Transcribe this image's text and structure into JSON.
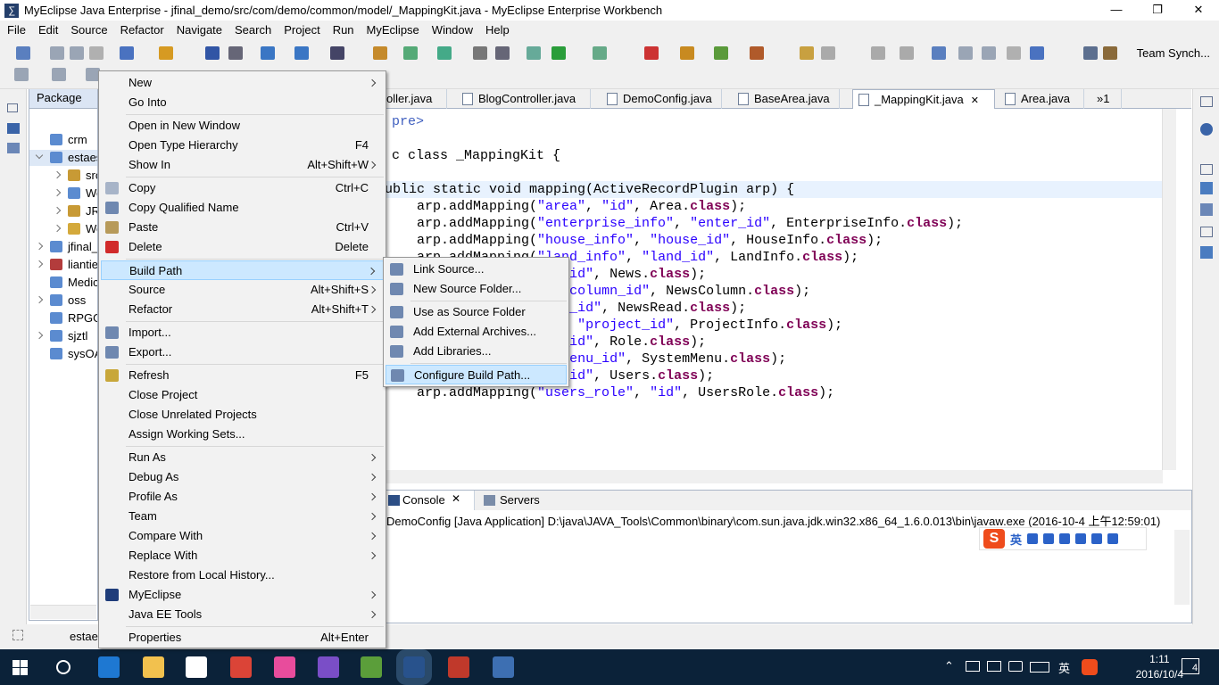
{
  "window": {
    "title": "MyEclipse Java Enterprise - jfinal_demo/src/com/demo/common/model/_MappingKit.java - MyEclipse Enterprise Workbench",
    "minimize": "—",
    "maximize": "❐",
    "close": "✕"
  },
  "menubar": [
    "File",
    "Edit",
    "Source",
    "Refactor",
    "Navigate",
    "Search",
    "Project",
    "Run",
    "MyEclipse",
    "Window",
    "Help"
  ],
  "toolbar": {
    "team_sync": "Team Synch..."
  },
  "package_explorer": {
    "tab": "Package",
    "items": [
      "crm",
      "estaes",
      "src",
      "We",
      "JR",
      "We",
      "jfinal_",
      "liantie",
      "Medic",
      "oss",
      "RPGG",
      "sjztl",
      "sysOA"
    ]
  },
  "editor_tabs": [
    "oller.java",
    "BlogController.java",
    "DemoConfig.java",
    "BaseArea.java",
    "_MappingKit.java",
    "Area.java",
    "»1"
  ],
  "code_lines": [
    {
      "a": "pre>",
      "cls": "cm"
    },
    {
      "a": "c class _MappingKit {",
      "cls": "decl"
    },
    {
      "a": "ublic static void mapping(ActiveRecordPlugin arp) {",
      "cls": "decl2"
    },
    {
      "pre": "    arp.addMapping(",
      "s1": "\"area\"",
      "m": ", ",
      "s2": "\"id\"",
      "post": ", Area.",
      "k": "class",
      "end": ");"
    },
    {
      "pre": "    arp.addMapping(",
      "s1": "\"enterprise_info\"",
      "m": ", ",
      "s2": "\"enter_id\"",
      "post": ", EnterpriseInfo.",
      "k": "class",
      "end": ");"
    },
    {
      "pre": "    arp.addMapping(",
      "s1": "\"house_info\"",
      "m": ", ",
      "s2": "\"house_id\"",
      "post": ", HouseInfo.",
      "k": "class",
      "end": ");"
    },
    {
      "pre": "    arp.addMapping(",
      "s1": "\"land_info\"",
      "m": ", ",
      "s2": "\"land_id\"",
      "post": ", LandInfo.",
      "k": "class",
      "end": ");"
    },
    {
      "pre": "              ",
      "s1": "\"",
      "m": ", ",
      "s2": "\"news_id\"",
      "post": ", News.",
      "k": "class",
      "end": ");"
    },
    {
      "pre": "            ",
      "s1": "_column\"",
      "m": ", ",
      "s2": "\"column_id\"",
      "post": ", NewsColumn.",
      "k": "class",
      "end": ");"
    },
    {
      "pre": "            ",
      "s1": "_read\"",
      "m": ", ",
      "s2": "\"nr_id\"",
      "post": ", NewsRead.",
      "k": "class",
      "end": ");"
    },
    {
      "pre": "             ",
      "s1": "ect_info\"",
      "m": ", ",
      "s2": "\"project_id\"",
      "post": ", ProjectInfo.",
      "k": "class",
      "end": ");"
    },
    {
      "pre": "              ",
      "s1": "\"",
      "m": ", ",
      "s2": "\"role_id\"",
      "post": ", Role.",
      "k": "class",
      "end": ");"
    },
    {
      "pre": "           ",
      "s1": "em_menu\"",
      "m": ", ",
      "s2": "\"menu_id\"",
      "post": ", SystemMenu.",
      "k": "class",
      "end": ");"
    },
    {
      "pre": "             ",
      "s1": "s\"",
      "m": ", ",
      "s2": "\"user_id\"",
      "post": ", Users.",
      "k": "class",
      "end": ");"
    },
    {
      "pre": "    arp.addMapping(",
      "s1": "\"users_role\"",
      "m": ", ",
      "s2": "\"id\"",
      "post": ", UsersRole.",
      "k": "class",
      "end": ");"
    }
  ],
  "console": {
    "tabs": [
      "Console",
      "Servers"
    ],
    "description": "DemoConfig [Java Application] D:\\java\\JAVA_Tools\\Common\\binary\\com.sun.java.jdk.win32.x86_64_1.6.0.013\\bin\\javaw.exe (2016-10-4 上午12:59:01)"
  },
  "ime": {
    "logo": "S",
    "mode": "英"
  },
  "statusbar": {
    "text": "estae"
  },
  "context_menu": [
    {
      "label": "New",
      "sub": true
    },
    {
      "label": "Go Into"
    },
    {
      "sep": true
    },
    {
      "label": "Open in New Window"
    },
    {
      "label": "Open Type Hierarchy",
      "acc": "F4"
    },
    {
      "label": "Show In",
      "acc": "Alt+Shift+W",
      "sub": true
    },
    {
      "sep": true
    },
    {
      "label": "Copy",
      "acc": "Ctrl+C",
      "icon": "copy-icon"
    },
    {
      "label": "Copy Qualified Name",
      "icon": "copy-qualified-icon"
    },
    {
      "label": "Paste",
      "acc": "Ctrl+V",
      "icon": "paste-icon"
    },
    {
      "label": "Delete",
      "acc": "Delete",
      "icon": "delete-icon"
    },
    {
      "sep": true
    },
    {
      "label": "Build Path",
      "sub": true,
      "highlight": true
    },
    {
      "label": "Source",
      "acc": "Alt+Shift+S",
      "sub": true
    },
    {
      "label": "Refactor",
      "acc": "Alt+Shift+T",
      "sub": true
    },
    {
      "sep": true
    },
    {
      "label": "Import...",
      "icon": "import-icon"
    },
    {
      "label": "Export...",
      "icon": "export-icon"
    },
    {
      "sep": true
    },
    {
      "label": "Refresh",
      "acc": "F5",
      "icon": "refresh-icon"
    },
    {
      "label": "Close Project"
    },
    {
      "label": "Close Unrelated Projects"
    },
    {
      "label": "Assign Working Sets..."
    },
    {
      "sep": true
    },
    {
      "label": "Run As",
      "sub": true
    },
    {
      "label": "Debug As",
      "sub": true
    },
    {
      "label": "Profile As",
      "sub": true
    },
    {
      "label": "Team",
      "sub": true
    },
    {
      "label": "Compare With",
      "sub": true
    },
    {
      "label": "Replace With",
      "sub": true
    },
    {
      "label": "Restore from Local History..."
    },
    {
      "label": "MyEclipse",
      "sub": true,
      "icon": "myeclipse-icon"
    },
    {
      "label": "Java EE Tools",
      "sub": true
    },
    {
      "sep": true
    },
    {
      "label": "Properties",
      "acc": "Alt+Enter"
    }
  ],
  "submenu": [
    {
      "label": "Link Source...",
      "icon": "link-source-icon"
    },
    {
      "label": "New Source Folder...",
      "icon": "new-source-folder-icon"
    },
    {
      "sep": true
    },
    {
      "label": "Use as Source Folder",
      "icon": "use-source-folder-icon"
    },
    {
      "label": "Add External Archives...",
      "icon": "add-archives-icon"
    },
    {
      "label": "Add Libraries...",
      "icon": "add-libraries-icon"
    },
    {
      "sep": true
    },
    {
      "label": "Configure Build Path...",
      "icon": "configure-build-path-icon",
      "highlight": true
    }
  ],
  "taskbar": {
    "time": "1:11",
    "date": "2016/10/4",
    "ime": "英",
    "notifications": "4"
  }
}
